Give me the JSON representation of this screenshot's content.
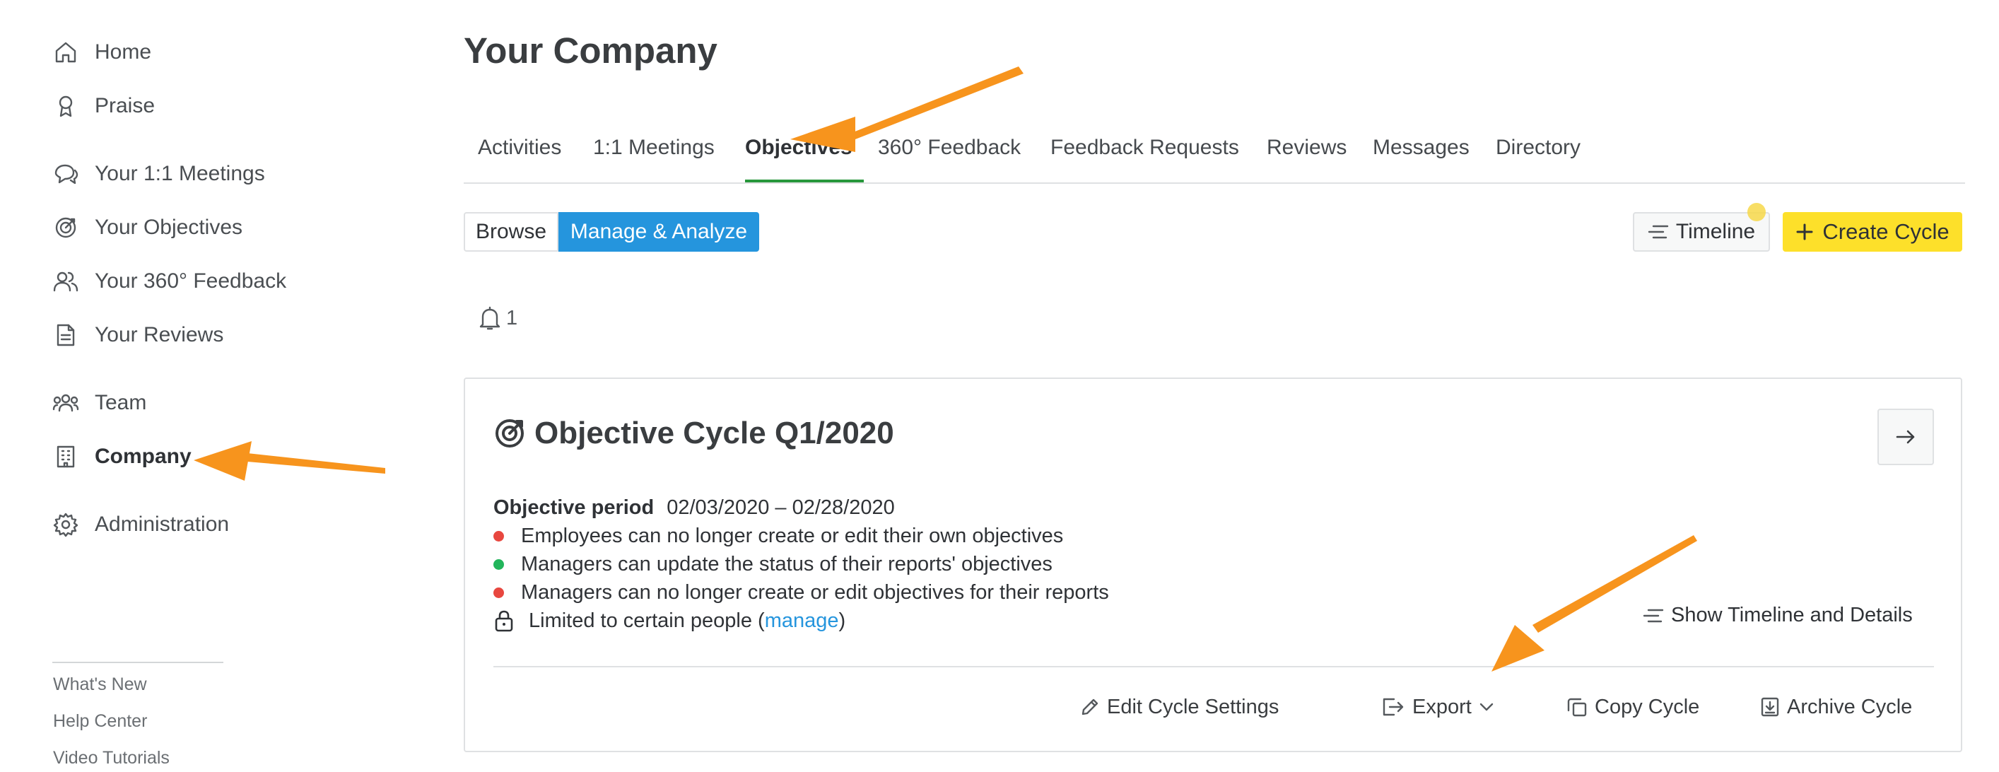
{
  "sidebar": {
    "items": [
      {
        "label": "Home",
        "icon": "home-icon"
      },
      {
        "label": "Praise",
        "icon": "ribbon-icon"
      },
      {
        "label": "Your 1:1 Meetings",
        "icon": "chat-bubbles-icon"
      },
      {
        "label": "Your Objectives",
        "icon": "target-icon"
      },
      {
        "label": "Your 360° Feedback",
        "icon": "people-icon"
      },
      {
        "label": "Your Reviews",
        "icon": "document-icon"
      },
      {
        "label": "Team",
        "icon": "team-icon"
      },
      {
        "label": "Company",
        "icon": "building-icon",
        "active": true
      },
      {
        "label": "Administration",
        "icon": "gear-icon"
      }
    ],
    "footer": [
      "What's New",
      "Help Center",
      "Video Tutorials"
    ]
  },
  "page": {
    "title": "Your Company",
    "tabs": [
      "Activities",
      "1:1 Meetings",
      "Objectives",
      "360° Feedback",
      "Feedback Requests",
      "Reviews",
      "Messages",
      "Directory"
    ],
    "active_tab": "Objectives"
  },
  "toolbar": {
    "browse": "Browse",
    "manage_analyze": "Manage & Analyze",
    "timeline": "Timeline",
    "create_cycle": "Create Cycle",
    "notification_count": "1"
  },
  "cycle": {
    "title": "Objective Cycle Q1/2020",
    "period_label": "Objective period",
    "period_value": "02/03/2020 – 02/28/2020",
    "rules": [
      {
        "text": "Employees can no longer create or edit their own objectives",
        "status_color": "#e8473f"
      },
      {
        "text": "Managers can update the status of their reports' objectives",
        "status_color": "#22b55b"
      },
      {
        "text": "Managers can no longer create or edit objectives for their reports",
        "status_color": "#e8473f"
      }
    ],
    "access_text": "Limited to certain people (",
    "access_link": "manage",
    "access_close": ")",
    "show_timeline": "Show Timeline and Details",
    "actions": {
      "edit": "Edit Cycle Settings",
      "export": "Export",
      "copy": "Copy Cycle",
      "archive": "Archive Cycle"
    }
  },
  "colors": {
    "accent_blue": "#2595dd",
    "create_yellow": "#fde02a",
    "tab_underline_green": "#27973b",
    "annotation_orange": "#f7941d"
  }
}
